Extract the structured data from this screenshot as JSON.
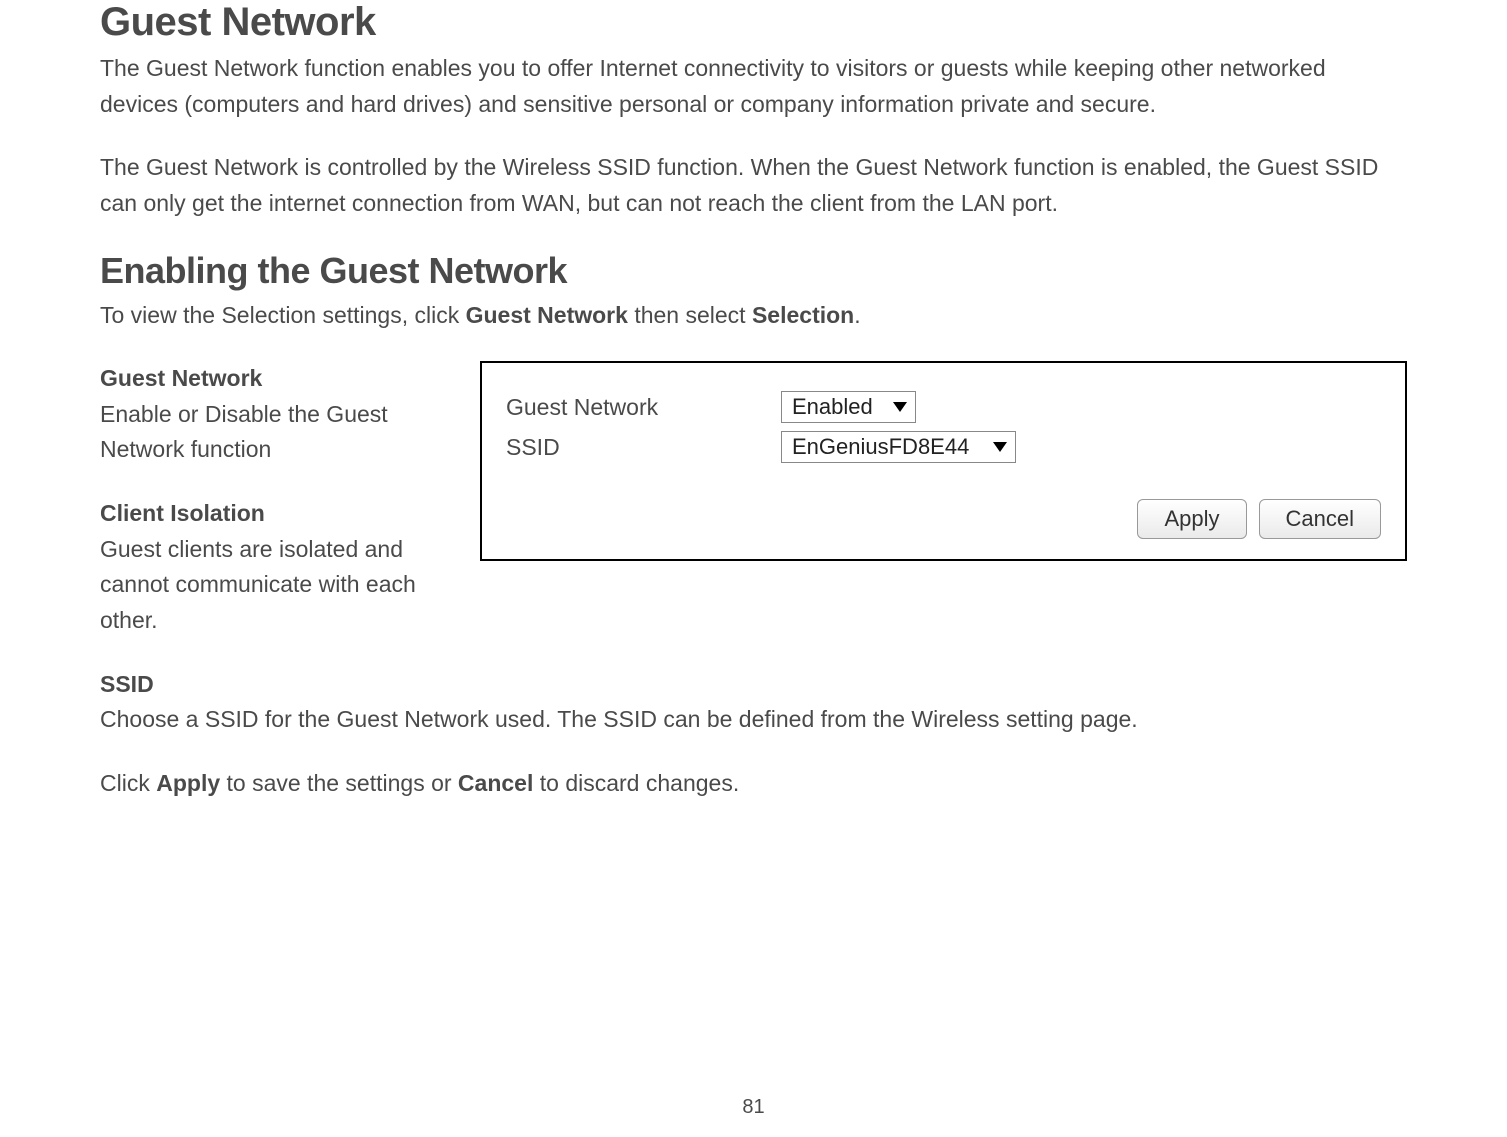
{
  "page": {
    "title": "Guest Network",
    "intro1": "The Guest Network function enables you to offer Internet connectivity to visitors or guests while keeping other networked devices (computers and hard drives) and sensitive personal or company information private and secure.",
    "intro2": "The Guest Network is controlled by the Wireless SSID function. When the Guest Network function is enabled, the Guest SSID can only get the internet connection from WAN, but can not reach the client from the LAN port.",
    "subtitle": "Enabling the Guest Network",
    "subintro_pre": "To view the Selection settings, click ",
    "subintro_b1": "Guest Network",
    "subintro_mid": " then select ",
    "subintro_b2": "Selection",
    "subintro_end": ".",
    "defs": {
      "gn_title": "Guest Network",
      "gn_body": "Enable or Disable the Guest Network function",
      "ci_title": "Client Isolation",
      "ci_body": "Guest clients are isolated and cannot communicate with each other.",
      "ssid_title": "SSID",
      "ssid_body": "Choose a SSID for the Guest Network used. The SSID can be defined from the Wireless setting page."
    },
    "final_pre": "Click ",
    "final_b1": "Apply",
    "final_mid": " to save the settings or ",
    "final_b2": "Cancel",
    "final_end": " to discard changes.",
    "page_number": "81"
  },
  "settings": {
    "row1_label": "Guest Network",
    "row1_value": "Enabled",
    "row2_label": "SSID",
    "row2_value": "EnGeniusFD8E44",
    "apply": "Apply",
    "cancel": "Cancel"
  }
}
